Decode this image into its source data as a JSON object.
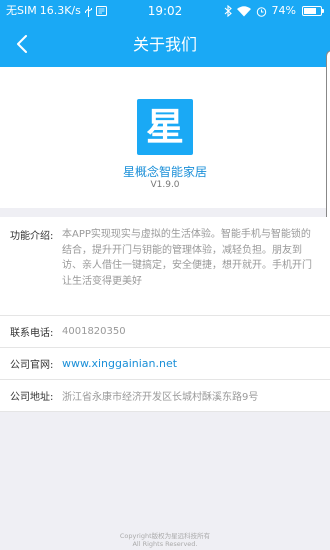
{
  "status_bar": {
    "carrier": "无SIM",
    "speed": "16.3K/s",
    "time": "19:02",
    "battery": "74%",
    "battery_level": 0.74
  },
  "header": {
    "title": "关于我们"
  },
  "app": {
    "logo_char": "星",
    "name": "星概念智能家居",
    "version": "V1.9.0"
  },
  "info": {
    "desc_label": "功能介绍:",
    "desc_text": "本APP实现现实与虚拟的生活体验。智能手机与智能锁的结合，提升开门与钥能的管理体验，减轻负担。朋友到访、亲人借住一键搞定，安全便捷，想开就开。手机开门让生活变得更美好",
    "phone_label": "联系电话:",
    "phone_value": "4001820350",
    "website_label": "公司官网:",
    "website_value": "www.xinggainian.net",
    "address_label": "公司地址:",
    "address_value": "浙江省永康市经济开发区长城村酥溪东路9号"
  },
  "footer": {
    "line1": "Copyright版权为星远科技所有",
    "line2": "All Rights Reserved."
  },
  "colors": {
    "brand": "#1aa9f5",
    "link": "#1a8fd8",
    "background": "#efeff4"
  },
  "icons": [
    "usb-icon",
    "notification-icon",
    "bluetooth-icon",
    "wifi-icon",
    "alarm-icon",
    "battery-icon",
    "back-arrow-icon"
  ]
}
